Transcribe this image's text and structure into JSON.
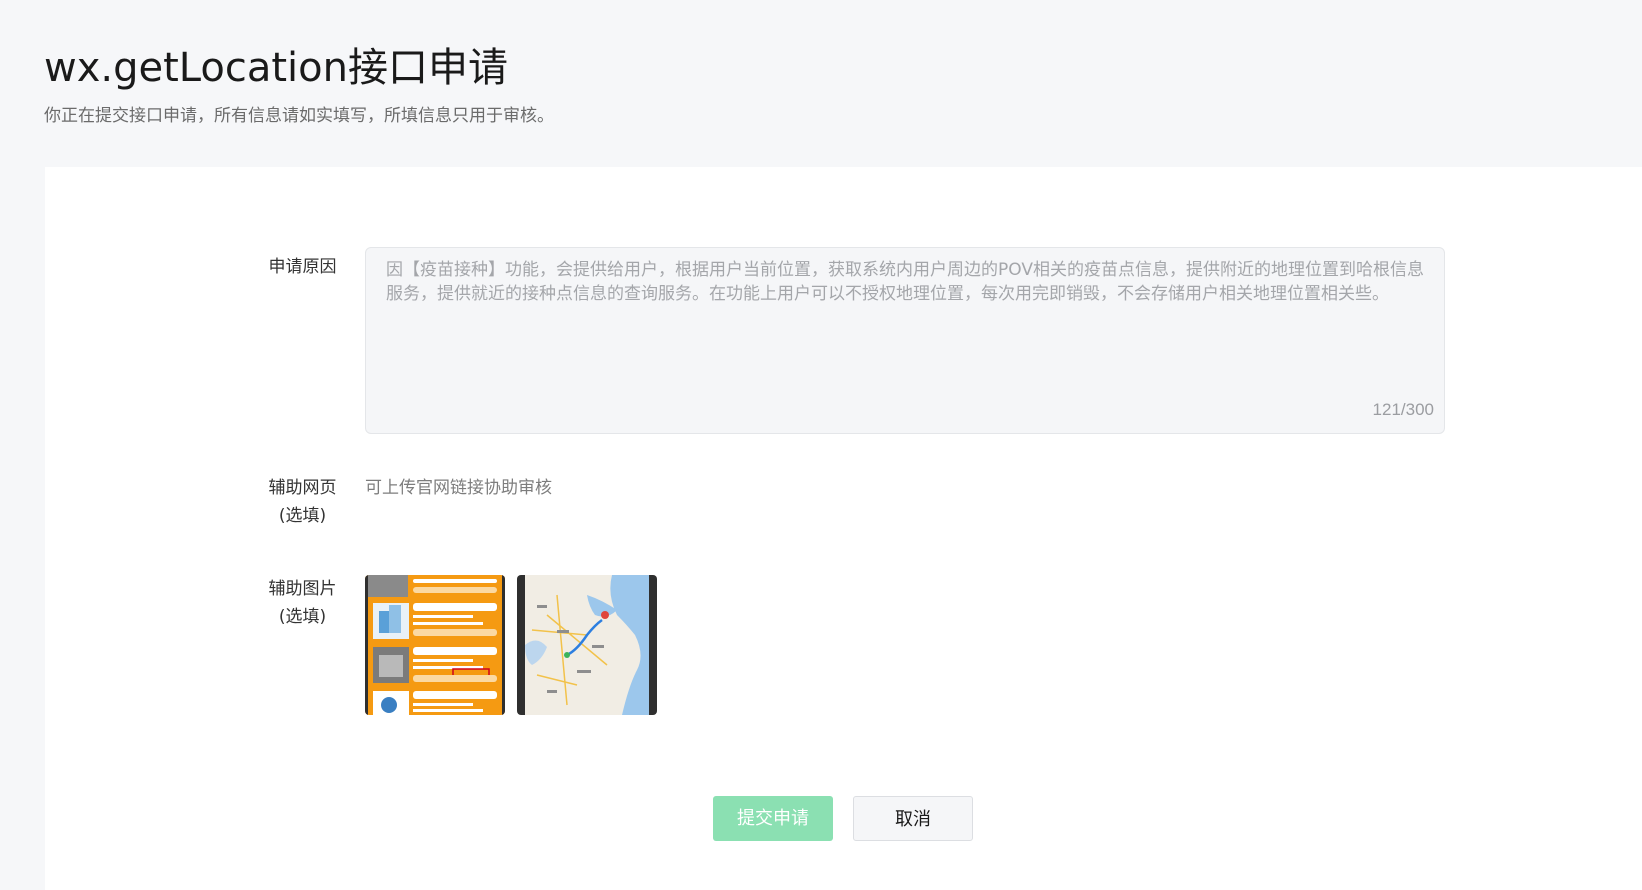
{
  "header": {
    "title": "wx.getLocation接口申请",
    "subtitle": "你正在提交接口申请，所有信息请如实填写，所填信息只用于审核。"
  },
  "form": {
    "reason": {
      "label": "申请原因",
      "value": "因【疫苗接种】功能，会提供给用户，根据用户当前位置，获取系统内用户周边的POV相关的疫苗点信息，提供附近的地理位置到哈根信息服务，提供就近的接种点信息的查询服务。在功能上用户可以不授权地理位置，每次用完即销毁，不会存储用户相关地理位置相关些。",
      "counter": "121/300"
    },
    "webpage": {
      "label_line1": "辅助网页",
      "label_line2": "(选填)",
      "hint": "可上传官网链接协助审核"
    },
    "images": {
      "label_line1": "辅助图片",
      "label_line2": "(选填)",
      "items": [
        {
          "name": "vaccine-list-screenshot",
          "accent": "#f59a12"
        },
        {
          "name": "map-route-screenshot",
          "accent": "#9cc7ec"
        }
      ]
    }
  },
  "actions": {
    "submit_label": "提交申请",
    "cancel_label": "取消"
  },
  "colors": {
    "primary_disabled": "#8be0b2",
    "background": "#f6f7f9",
    "card": "#ffffff"
  }
}
